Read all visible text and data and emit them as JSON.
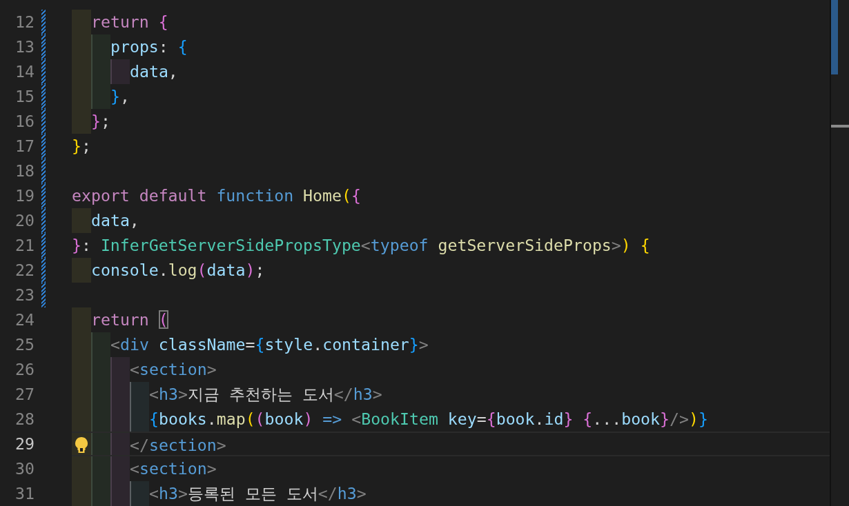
{
  "editor": {
    "lines": [
      {
        "number": "12",
        "guides": [
          {
            "color": "#2f2e22"
          }
        ],
        "modified": true,
        "current": false,
        "lightbulb": false,
        "tokens": [
          {
            "kind": "kw",
            "text": "return"
          },
          {
            "kind": "b2",
            "text": " {"
          }
        ]
      },
      {
        "number": "13",
        "guides": [
          {
            "color": "#2f2e22"
          },
          {
            "color": "#242b24"
          }
        ],
        "modified": true,
        "current": false,
        "lightbulb": false,
        "tokens": [
          {
            "kind": "var",
            "text": "props"
          },
          {
            "kind": "plain",
            "text": ":"
          },
          {
            "kind": "b3",
            "text": " {"
          }
        ]
      },
      {
        "number": "14",
        "guides": [
          {
            "color": "#2f2e22"
          },
          {
            "color": "#242b24"
          },
          {
            "color": "#2d262e"
          }
        ],
        "modified": true,
        "current": false,
        "lightbulb": false,
        "tokens": [
          {
            "kind": "var",
            "text": "data"
          },
          {
            "kind": "plain",
            "text": ","
          }
        ]
      },
      {
        "number": "15",
        "guides": [
          {
            "color": "#2f2e22"
          },
          {
            "color": "#242b24"
          }
        ],
        "modified": true,
        "current": false,
        "lightbulb": false,
        "tokens": [
          {
            "kind": "b3",
            "text": "}"
          },
          {
            "kind": "plain",
            "text": ","
          }
        ]
      },
      {
        "number": "16",
        "guides": [
          {
            "color": "#2f2e22"
          }
        ],
        "modified": true,
        "current": false,
        "lightbulb": false,
        "tokens": [
          {
            "kind": "b2",
            "text": "}"
          },
          {
            "kind": "plain",
            "text": ";"
          }
        ]
      },
      {
        "number": "17",
        "modified": true,
        "current": false,
        "lightbulb": false,
        "tokens": [
          {
            "kind": "b1",
            "text": "}"
          },
          {
            "kind": "plain",
            "text": ";"
          }
        ]
      },
      {
        "number": "18",
        "modified": true,
        "current": false,
        "lightbulb": false
      },
      {
        "number": "19",
        "modified": true,
        "current": false,
        "lightbulb": false,
        "tokens": [
          {
            "kind": "kw",
            "text": "export default"
          },
          {
            "kind": "fn",
            "text": " function"
          },
          {
            "kind": "name",
            "text": " Home"
          },
          {
            "kind": "b1",
            "text": "("
          },
          {
            "kind": "b2",
            "text": "{"
          }
        ]
      },
      {
        "number": "20",
        "guides": [
          {
            "color": "#2f2e22"
          }
        ],
        "modified": true,
        "current": false,
        "lightbulb": false,
        "tokens": [
          {
            "kind": "var",
            "text": "data"
          },
          {
            "kind": "plain",
            "text": ","
          }
        ]
      },
      {
        "number": "21",
        "modified": true,
        "current": false,
        "lightbulb": false,
        "tokens": [
          {
            "kind": "b2",
            "text": "}"
          },
          {
            "kind": "plain",
            "text": ":"
          },
          {
            "kind": "type",
            "text": " InferGetServerSidePropsType"
          },
          {
            "kind": "tag",
            "text": "<"
          },
          {
            "kind": "fn",
            "text": "typeof"
          },
          {
            "kind": "name",
            "text": " getServerSideProps"
          },
          {
            "kind": "tag",
            "text": ">"
          },
          {
            "kind": "b1",
            "text": ")"
          },
          {
            "kind": "b1",
            "text": " {"
          }
        ]
      },
      {
        "number": "22",
        "guides": [
          {
            "color": "#2f2e22"
          }
        ],
        "modified": true,
        "current": false,
        "lightbulb": false,
        "tokens": [
          {
            "kind": "var",
            "text": "console"
          },
          {
            "kind": "plain",
            "text": "."
          },
          {
            "kind": "name",
            "text": "log"
          },
          {
            "kind": "b2",
            "text": "("
          },
          {
            "kind": "var",
            "text": "data"
          },
          {
            "kind": "b2",
            "text": ")"
          },
          {
            "kind": "plain",
            "text": ";"
          }
        ]
      },
      {
        "number": "23",
        "modified": true,
        "current": false,
        "lightbulb": false
      },
      {
        "number": "24",
        "guides": [
          {
            "color": "#2f2e22"
          }
        ],
        "modified": false,
        "current": false,
        "lightbulb": false,
        "tokens": [
          {
            "kind": "kw",
            "text": "return "
          },
          {
            "kind": "b2-matched",
            "text": "("
          }
        ]
      },
      {
        "number": "25",
        "guides": [
          {
            "color": "#2f2e22"
          },
          {
            "color": "#242b24"
          }
        ],
        "modified": false,
        "current": false,
        "lightbulb": false,
        "tokens": [
          {
            "kind": "tag",
            "text": "<"
          },
          {
            "kind": "fn",
            "text": "div"
          },
          {
            "kind": "var",
            "text": " className"
          },
          {
            "kind": "plain",
            "text": "="
          },
          {
            "kind": "b3",
            "text": "{"
          },
          {
            "kind": "var",
            "text": "style"
          },
          {
            "kind": "plain",
            "text": "."
          },
          {
            "kind": "var",
            "text": "container"
          },
          {
            "kind": "b3",
            "text": "}"
          },
          {
            "kind": "tag",
            "text": ">"
          }
        ]
      },
      {
        "number": "26",
        "guides": [
          {
            "color": "#2f2e22"
          },
          {
            "color": "#242b24"
          },
          {
            "color": "#2d262e"
          }
        ],
        "modified": false,
        "current": false,
        "lightbulb": false,
        "tokens": [
          {
            "kind": "tag",
            "text": "<"
          },
          {
            "kind": "fn",
            "text": "section"
          },
          {
            "kind": "tag",
            "text": ">"
          }
        ]
      },
      {
        "number": "27",
        "guides": [
          {
            "color": "#2f2e22"
          },
          {
            "color": "#242b24"
          },
          {
            "color": "#2d262e"
          },
          {
            "color": "#232a2c"
          }
        ],
        "modified": false,
        "current": false,
        "lightbulb": false,
        "tokens": [
          {
            "kind": "tag",
            "text": "<"
          },
          {
            "kind": "fn",
            "text": "h3"
          },
          {
            "kind": "tag",
            "text": ">"
          },
          {
            "kind": "plain",
            "text": "지금 추천하는 도서"
          },
          {
            "kind": "tag",
            "text": "</"
          },
          {
            "kind": "fn",
            "text": "h3"
          },
          {
            "kind": "tag",
            "text": ">"
          }
        ]
      },
      {
        "number": "28",
        "guides": [
          {
            "color": "#2f2e22"
          },
          {
            "color": "#242b24"
          },
          {
            "color": "#2d262e"
          },
          {
            "color": "#232a2c"
          }
        ],
        "modified": false,
        "current": false,
        "lightbulb": false,
        "tokens": [
          {
            "kind": "b3",
            "text": "{"
          },
          {
            "kind": "var",
            "text": "books"
          },
          {
            "kind": "plain",
            "text": "."
          },
          {
            "kind": "name",
            "text": "map"
          },
          {
            "kind": "b1",
            "text": "("
          },
          {
            "kind": "b2",
            "text": "("
          },
          {
            "kind": "var",
            "text": "book"
          },
          {
            "kind": "b2",
            "text": ")"
          },
          {
            "kind": "fn",
            "text": " =>"
          },
          {
            "kind": "tag",
            "text": " <"
          },
          {
            "kind": "type",
            "text": "BookItem"
          },
          {
            "kind": "var",
            "text": " key"
          },
          {
            "kind": "plain",
            "text": "="
          },
          {
            "kind": "b2",
            "text": "{"
          },
          {
            "kind": "var",
            "text": "book"
          },
          {
            "kind": "plain",
            "text": "."
          },
          {
            "kind": "var",
            "text": "id"
          },
          {
            "kind": "b2",
            "text": "}"
          },
          {
            "kind": "b2",
            "text": " {"
          },
          {
            "kind": "plain",
            "text": "..."
          },
          {
            "kind": "var",
            "text": "book"
          },
          {
            "kind": "b2",
            "text": "}"
          },
          {
            "kind": "tag",
            "text": "/>"
          },
          {
            "kind": "b1",
            "text": ")"
          },
          {
            "kind": "b3",
            "text": "}"
          }
        ]
      },
      {
        "number": "29",
        "guides": [
          {
            "color": "#2f2e22"
          },
          {
            "color": "#242b24"
          },
          {
            "color": "#2d262e"
          }
        ],
        "modified": false,
        "current": true,
        "lightbulb": true,
        "tokens": [
          {
            "kind": "tag",
            "text": "</"
          },
          {
            "kind": "fn",
            "text": "section"
          },
          {
            "kind": "tag",
            "text": ">"
          }
        ]
      },
      {
        "number": "30",
        "guides": [
          {
            "color": "#2f2e22"
          },
          {
            "color": "#242b24"
          },
          {
            "color": "#2d262e"
          }
        ],
        "modified": false,
        "current": false,
        "lightbulb": false,
        "tokens": [
          {
            "kind": "tag",
            "text": "<"
          },
          {
            "kind": "fn",
            "text": "section"
          },
          {
            "kind": "tag",
            "text": ">"
          }
        ]
      },
      {
        "number": "31",
        "guides": [
          {
            "color": "#2f2e22"
          },
          {
            "color": "#242b24"
          },
          {
            "color": "#2d262e"
          },
          {
            "color": "#232a2c"
          }
        ],
        "modified": false,
        "current": false,
        "lightbulb": false,
        "tokens": [
          {
            "kind": "tag",
            "text": "<"
          },
          {
            "kind": "fn",
            "text": "h3"
          },
          {
            "kind": "tag",
            "text": ">"
          },
          {
            "kind": "plain",
            "text": "등록된 모든 도서"
          },
          {
            "kind": "tag",
            "text": "</"
          },
          {
            "kind": "fn",
            "text": "h3"
          },
          {
            "kind": "tag",
            "text": ">"
          }
        ]
      }
    ]
  }
}
